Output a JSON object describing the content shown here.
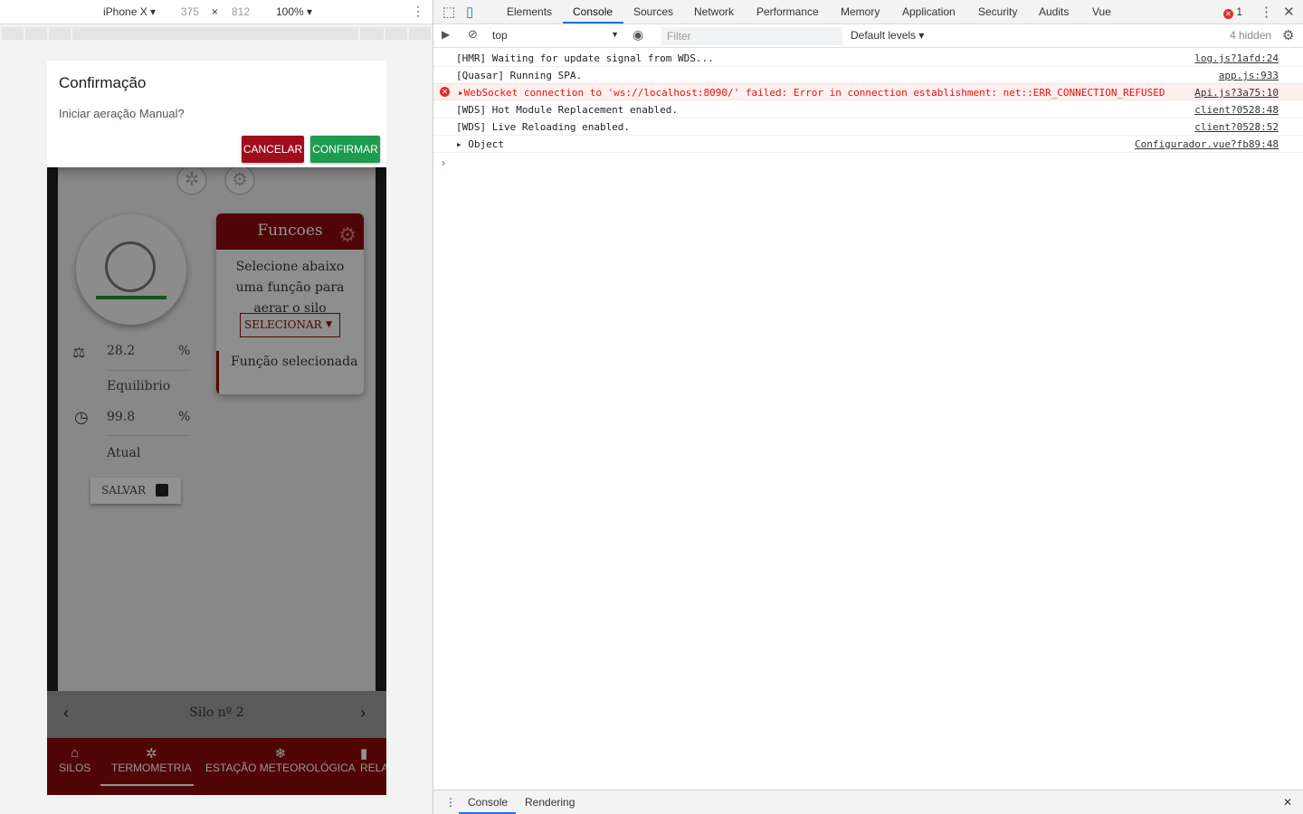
{
  "emulation": {
    "device": "iPhone X",
    "width": "375",
    "times": "×",
    "height": "812",
    "zoom": "100%"
  },
  "app": {
    "funcoes_title": "Funcoes",
    "funcoes_desc": "Selecione abaixo uma função para aerar o silo",
    "select_label": "SELECIONAR",
    "funcao_selecionada": "Função selecionada",
    "equilibrio_value": "28.2",
    "equilibrio_unit": "%",
    "equilibrio_label": "Equilibrio",
    "atual_value": "99.8",
    "atual_unit": "%",
    "atual_label": "Atual",
    "save_label": "SALVAR",
    "silo_label": "Silo nº 2",
    "nav": [
      "SILOS",
      "TERMOMETRIA",
      "ESTAÇÃO METEOROLÓGICA",
      "RELA"
    ]
  },
  "dialog": {
    "title": "Confirmação",
    "message": "Iniciar aeração Manual?",
    "cancel": "CANCELAR",
    "confirm": "CONFIRMAR"
  },
  "devtools": {
    "tabs": [
      "Elements",
      "Console",
      "Sources",
      "Network",
      "Performance",
      "Memory",
      "Application",
      "Security",
      "Audits",
      "Vue"
    ],
    "active_tab": "Console",
    "error_count": "1",
    "context": "top",
    "filter_placeholder": "Filter",
    "levels": "Default levels ▾",
    "hidden": "4 hidden",
    "logs": [
      {
        "msg": "[HMR] Waiting for update signal from WDS...",
        "src": "log.js?1afd:24"
      },
      {
        "msg": "[Quasar] Running SPA.",
        "src": "app.js:933"
      },
      {
        "msg": "▸WebSocket connection to 'ws://localhost:8090/' failed: Error in connection establishment: net::ERR_CONNECTION_REFUSED",
        "src": "Api.js?3a75:10"
      },
      {
        "msg": "[WDS] Hot Module Replacement enabled.",
        "src": "client?0528:48"
      },
      {
        "msg": "[WDS] Live Reloading enabled.",
        "src": "client?0528:52"
      },
      {
        "msg": "▸ Object",
        "src": "Configurador.vue?fb89:48"
      }
    ],
    "drawer_tabs": [
      "Console",
      "Rendering"
    ]
  },
  "colors": {
    "app_primary": "#8b0b0b",
    "cancel": "#a00d1c",
    "confirm": "#1e9b4e",
    "devtools_accent": "#1a73e8"
  }
}
